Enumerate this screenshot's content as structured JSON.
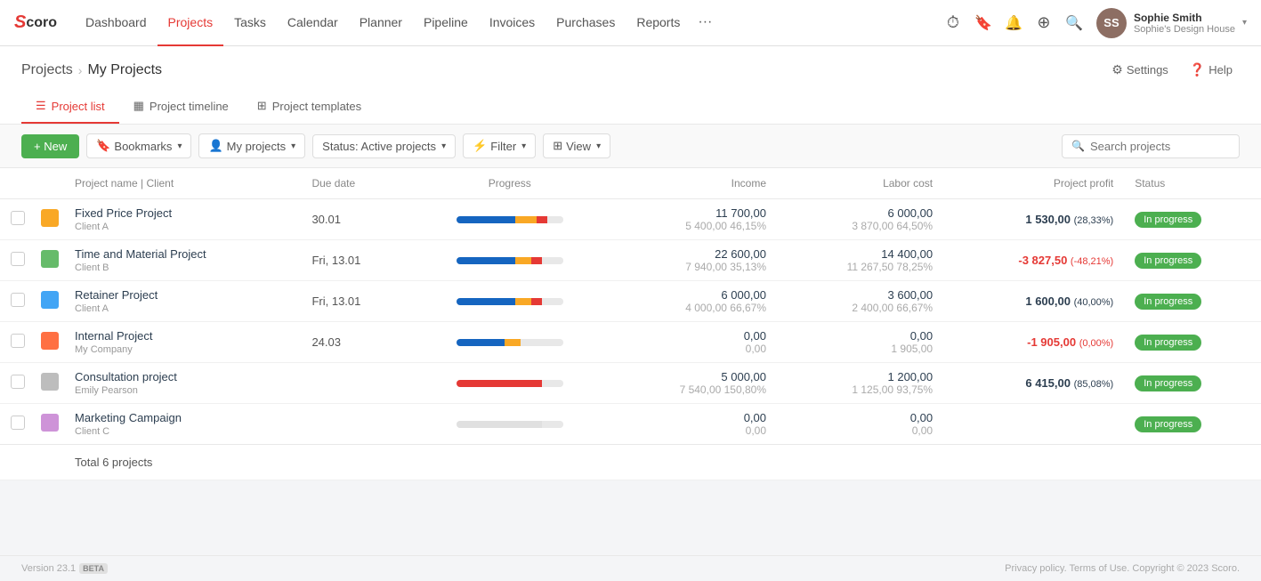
{
  "app": {
    "logo": "Scoro",
    "version": "Version 23.1",
    "beta": "BETA",
    "footer_right": "Privacy policy. Terms of Use. Copyright © 2023 Scoro."
  },
  "nav": {
    "items": [
      {
        "label": "Dashboard",
        "active": false
      },
      {
        "label": "Projects",
        "active": true
      },
      {
        "label": "Tasks",
        "active": false
      },
      {
        "label": "Calendar",
        "active": false
      },
      {
        "label": "Planner",
        "active": false
      },
      {
        "label": "Pipeline",
        "active": false
      },
      {
        "label": "Invoices",
        "active": false
      },
      {
        "label": "Purchases",
        "active": false
      },
      {
        "label": "Reports",
        "active": false
      },
      {
        "label": "...",
        "active": false
      }
    ],
    "user_name": "Sophie Smith",
    "user_org": "Sophie's Design House"
  },
  "page": {
    "breadcrumb_root": "Projects",
    "breadcrumb_child": "My Projects",
    "settings_label": "Settings",
    "help_label": "Help"
  },
  "tabs": [
    {
      "label": "Project list",
      "icon": "list-icon",
      "active": true
    },
    {
      "label": "Project timeline",
      "icon": "timeline-icon",
      "active": false
    },
    {
      "label": "Project templates",
      "icon": "templates-icon",
      "active": false
    }
  ],
  "toolbar": {
    "new_label": "+ New",
    "bookmarks_label": "Bookmarks",
    "my_projects_label": "My projects",
    "status_label": "Status: Active projects",
    "filter_label": "Filter",
    "view_label": "View",
    "search_placeholder": "Search projects"
  },
  "table": {
    "columns": [
      "",
      "",
      "Project name | Client",
      "Due date",
      "Progress",
      "Income",
      "Labor cost",
      "Project profit",
      "Status"
    ],
    "rows": [
      {
        "id": 1,
        "name": "Fixed Price Project",
        "client": "Client A",
        "icon_color": "#f9a825",
        "due_date": "30.01",
        "income_top": "11 700,00",
        "income_bot": "5 400,00",
        "income_pct": "46,15%",
        "labor_top": "6 000,00",
        "labor_bot": "3 870,00",
        "labor_pct": "64,50%",
        "profit": "1 530,00",
        "profit_suffix": "(28,33%)",
        "profit_type": "pos",
        "status": "In progress",
        "progress": [
          {
            "color": "#1565c0",
            "pct": 55
          },
          {
            "color": "#f9a825",
            "pct": 20
          },
          {
            "color": "#e53935",
            "pct": 10
          }
        ]
      },
      {
        "id": 2,
        "name": "Time and Material Project",
        "client": "Client B",
        "icon_color": "#66bb6a",
        "due_date": "Fri, 13.01",
        "income_top": "22 600,00",
        "income_bot": "7 940,00",
        "income_pct": "35,13%",
        "labor_top": "14 400,00",
        "labor_bot": "11 267,50",
        "labor_pct": "78,25%",
        "profit": "-3 827,50",
        "profit_suffix": "(-48,21%)",
        "profit_type": "neg",
        "status": "In progress",
        "progress": [
          {
            "color": "#1565c0",
            "pct": 55
          },
          {
            "color": "#f9a825",
            "pct": 15
          },
          {
            "color": "#e53935",
            "pct": 10
          }
        ]
      },
      {
        "id": 3,
        "name": "Retainer Project",
        "client": "Client A",
        "icon_color": "#42a5f5",
        "due_date": "Fri, 13.01",
        "income_top": "6 000,00",
        "income_bot": "4 000,00",
        "income_pct": "66,67%",
        "labor_top": "3 600,00",
        "labor_bot": "2 400,00",
        "labor_pct": "66,67%",
        "profit": "1 600,00",
        "profit_suffix": "(40,00%)",
        "profit_type": "pos",
        "status": "In progress",
        "progress": [
          {
            "color": "#1565c0",
            "pct": 55
          },
          {
            "color": "#f9a825",
            "pct": 15
          },
          {
            "color": "#e53935",
            "pct": 10
          }
        ]
      },
      {
        "id": 4,
        "name": "Internal Project",
        "client": "My Company",
        "icon_color": "#ff7043",
        "due_date": "24.03",
        "income_top": "0,00",
        "income_bot": "0,00",
        "income_pct": "",
        "labor_top": "0,00",
        "labor_bot": "1 905,00",
        "labor_pct": "",
        "profit": "-1 905,00",
        "profit_suffix": "(0,00%)",
        "profit_type": "neg",
        "status": "In progress",
        "progress": [
          {
            "color": "#1565c0",
            "pct": 45
          },
          {
            "color": "#f9a825",
            "pct": 15
          },
          {
            "color": "#e8e8e8",
            "pct": 30
          }
        ]
      },
      {
        "id": 5,
        "name": "Consultation project",
        "client": "Emily Pearson",
        "icon_color": "#bdbdbd",
        "due_date": "",
        "income_top": "5 000,00",
        "income_bot": "7 540,00",
        "income_pct": "150,80%",
        "labor_top": "1 200,00",
        "labor_bot": "1 125,00",
        "labor_pct": "93,75%",
        "profit": "6 415,00",
        "profit_suffix": "(85,08%)",
        "profit_type": "pos",
        "status": "In progress",
        "progress": [
          {
            "color": "#e53935",
            "pct": 80
          },
          {
            "color": "#e53935",
            "pct": 0
          },
          {
            "color": "#e8e8e8",
            "pct": 0
          }
        ]
      },
      {
        "id": 6,
        "name": "Marketing Campaign",
        "client": "Client C",
        "icon_color": "#ce93d8",
        "due_date": "",
        "income_top": "0,00",
        "income_bot": "0,00",
        "income_pct": "",
        "labor_top": "0,00",
        "labor_bot": "0,00",
        "labor_pct": "",
        "profit": "",
        "profit_suffix": "",
        "profit_type": "pos",
        "status": "In progress",
        "progress": [
          {
            "color": "#e0e0e0",
            "pct": 80
          },
          {
            "color": "#e0e0e0",
            "pct": 0
          },
          {
            "color": "#e0e0e0",
            "pct": 0
          }
        ]
      }
    ],
    "total_label": "Total 6 projects"
  }
}
